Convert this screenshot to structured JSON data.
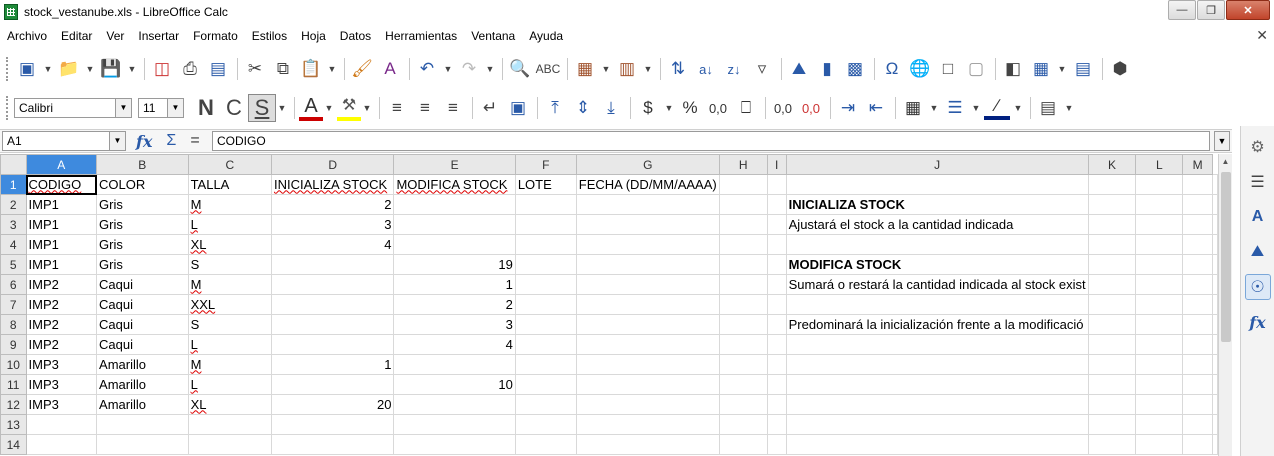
{
  "window": {
    "title": "stock_vestanube.xls - LibreOffice Calc"
  },
  "menu": [
    "Archivo",
    "Editar",
    "Ver",
    "Insertar",
    "Formato",
    "Estilos",
    "Hoja",
    "Datos",
    "Herramientas",
    "Ventana",
    "Ayuda"
  ],
  "toolbar": {
    "font_name": "Calibri",
    "font_size": "11",
    "bold_label": "N",
    "italic_label": "C",
    "underline_label": "S",
    "font_color_label": "A",
    "currency_label": "$",
    "percent_label": "%",
    "number_label": "0,0",
    "add_decimal_label": "0,0",
    "del_decimal_label": "0,0"
  },
  "formula_bar": {
    "cell_ref": "A1",
    "content": "CODIGO"
  },
  "sheet": {
    "columns": [
      "A",
      "B",
      "C",
      "D",
      "E",
      "F",
      "G",
      "H",
      "I",
      "J",
      "K",
      "L",
      "M"
    ],
    "rows": [
      {
        "n": "1",
        "cells": [
          "CODIGO",
          "COLOR",
          "TALLA",
          "INICIALIZA STOCK",
          "MODIFICA STOCK",
          "LOTE",
          "FECHA (DD/MM/AAAA)",
          "",
          "",
          "",
          "",
          "",
          ""
        ]
      },
      {
        "n": "2",
        "cells": [
          "IMP1",
          "Gris",
          "M",
          "2",
          "",
          "",
          "",
          "",
          "",
          "INICIALIZA STOCK",
          "",
          "",
          ""
        ]
      },
      {
        "n": "3",
        "cells": [
          "IMP1",
          "Gris",
          "L",
          "3",
          "",
          "",
          "",
          "",
          "",
          "Ajustará el stock a la cantidad indicada",
          "",
          "",
          ""
        ]
      },
      {
        "n": "4",
        "cells": [
          "IMP1",
          "Gris",
          "XL",
          "4",
          "",
          "",
          "",
          "",
          "",
          "",
          "",
          "",
          ""
        ]
      },
      {
        "n": "5",
        "cells": [
          "IMP1",
          "Gris",
          "S",
          "",
          "19",
          "",
          "",
          "",
          "",
          "MODIFICA STOCK",
          "",
          "",
          ""
        ]
      },
      {
        "n": "6",
        "cells": [
          "IMP2",
          "Caqui",
          "M",
          "",
          "1",
          "",
          "",
          "",
          "",
          "Sumará o restará la cantidad indicada al stock exist",
          "",
          "",
          ""
        ]
      },
      {
        "n": "7",
        "cells": [
          "IMP2",
          "Caqui",
          "XXL",
          "",
          "2",
          "",
          "",
          "",
          "",
          "",
          "",
          "",
          ""
        ]
      },
      {
        "n": "8",
        "cells": [
          "IMP2",
          "Caqui",
          "S",
          "",
          "3",
          "",
          "",
          "",
          "",
          "Predominará la inicialización frente a la modificació",
          "",
          "",
          ""
        ]
      },
      {
        "n": "9",
        "cells": [
          "IMP2",
          "Caqui",
          "L",
          "",
          "4",
          "",
          "",
          "",
          "",
          "",
          "",
          "",
          ""
        ]
      },
      {
        "n": "10",
        "cells": [
          "IMP3",
          "Amarillo",
          "M",
          "1",
          "",
          "",
          "",
          "",
          "",
          "",
          "",
          "",
          ""
        ]
      },
      {
        "n": "11",
        "cells": [
          "IMP3",
          "Amarillo",
          "L",
          "",
          "10",
          "",
          "",
          "",
          "",
          "",
          "",
          "",
          ""
        ]
      },
      {
        "n": "12",
        "cells": [
          "IMP3",
          "Amarillo",
          "XL",
          "20",
          "",
          "",
          "",
          "",
          "",
          "",
          "",
          "",
          ""
        ]
      },
      {
        "n": "13",
        "cells": [
          "",
          "",
          "",
          "",
          "",
          "",
          "",
          "",
          "",
          "",
          "",
          "",
          ""
        ]
      },
      {
        "n": "14",
        "cells": [
          "",
          "",
          "",
          "",
          "",
          "",
          "",
          "",
          "",
          "",
          "",
          "",
          ""
        ]
      }
    ]
  },
  "colors": {
    "selected_header": "#3e8ade",
    "font_color": "#cc0000",
    "highlight_color": "#ffff00"
  }
}
